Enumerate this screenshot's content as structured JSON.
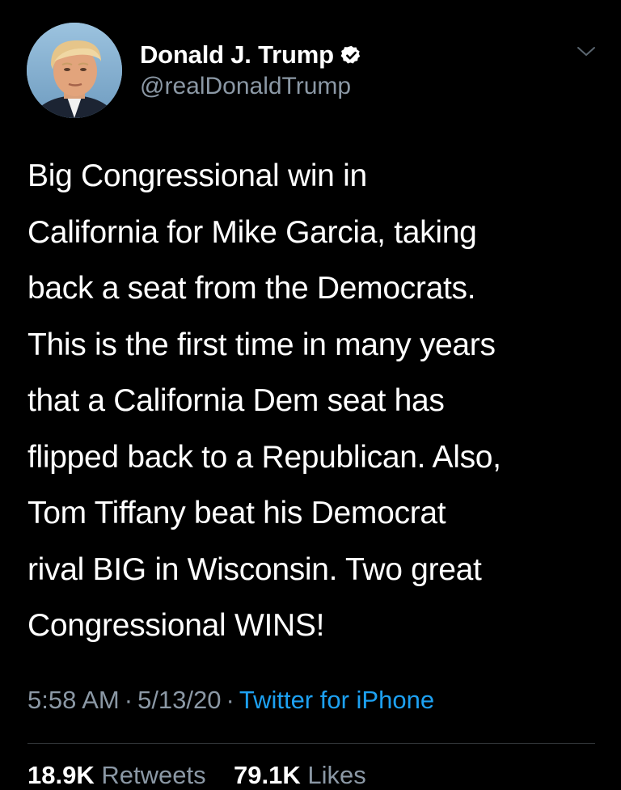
{
  "user": {
    "display_name": "Donald J. Trump",
    "handle": "@realDonaldTrump",
    "verified": true
  },
  "tweet": {
    "text": "Big Congressional win in\nCalifornia for Mike Garcia, taking\nback a seat from the Democrats.\nThis is the first time in many years\nthat a California Dem seat has\nflipped back to a Republican. Also,\nTom Tiffany beat his Democrat\nrival BIG in Wisconsin. Two great\nCongressional WINS!",
    "time": "5:58 AM",
    "separator": "·",
    "date": "5/13/20",
    "source": "Twitter for iPhone"
  },
  "stats": {
    "retweets_count": "18.9K",
    "retweets_label": "Retweets",
    "likes_count": "79.1K",
    "likes_label": "Likes"
  },
  "colors": {
    "background": "#000000",
    "text": "#ffffff",
    "secondary": "#8b98a5",
    "link": "#1da1f2",
    "divider": "#2f3336"
  }
}
